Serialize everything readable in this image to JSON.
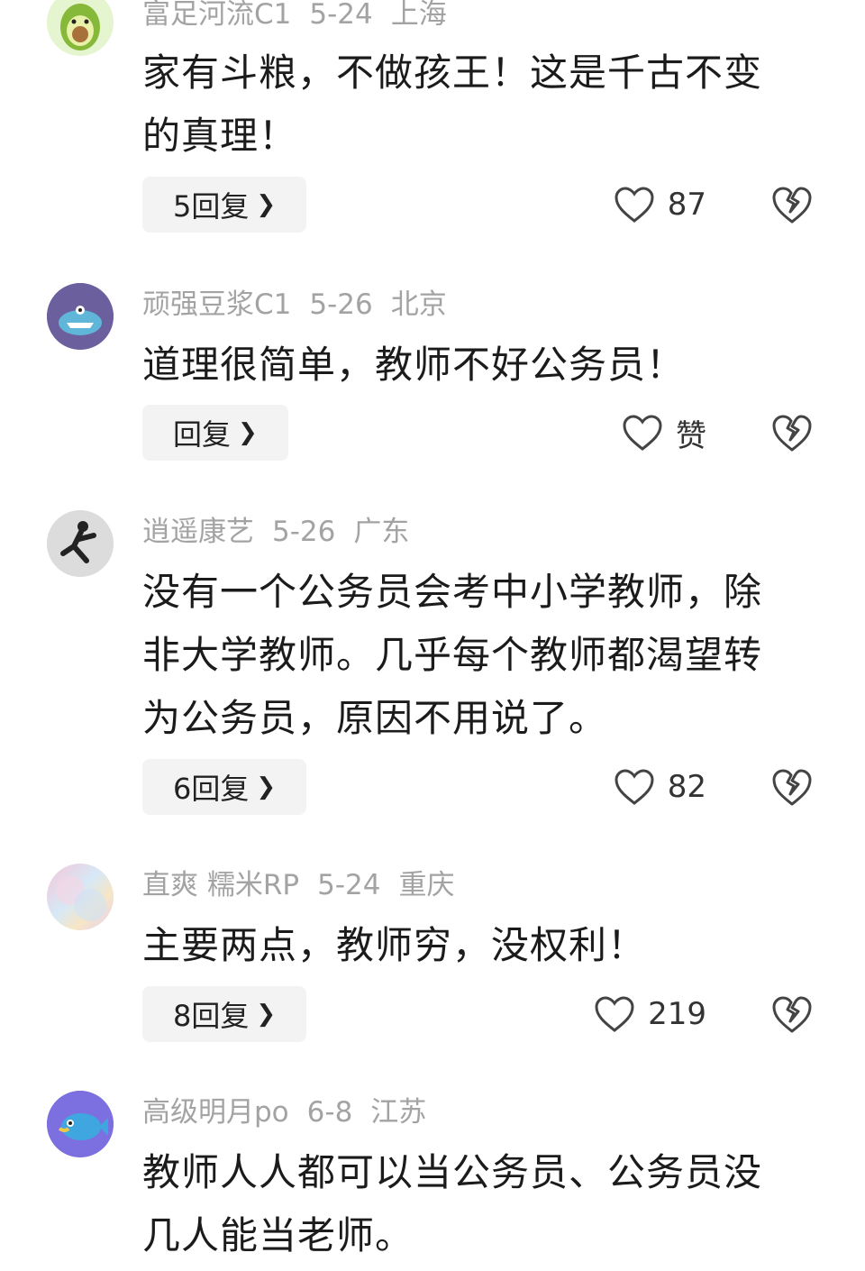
{
  "comments": [
    {
      "user": "富足河流C1",
      "date": "5-24",
      "location": "上海",
      "text": "家有斗粮，不做孩王！这是千古不变的真理！",
      "reply_label": "5回复",
      "likes": "87"
    },
    {
      "user": "顽强豆浆C1",
      "date": "5-26",
      "location": "北京",
      "text": "道理很简单，教师不好公务员！",
      "reply_label": "回复",
      "likes": "赞"
    },
    {
      "user": "逍遥康艺",
      "date": "5-26",
      "location": "广东",
      "text": "没有一个公务员会考中小学教师，除非大学教师。几乎每个教师都渴望转为公务员，原因不用说了。",
      "reply_label": "6回复",
      "likes": "82"
    },
    {
      "user": "直爽 糯米RP",
      "date": "5-24",
      "location": "重庆",
      "text": "主要两点，教师穷，没权利！",
      "reply_label": "8回复",
      "likes": "219"
    },
    {
      "user": "高级明月po",
      "date": "6-8",
      "location": "江苏",
      "text": "教师人人都可以当公务员、公务员没几人能当老师。"
    }
  ],
  "icons": {
    "like": "heart-outline-icon",
    "dislike": "broken-heart-icon",
    "reply_chevron": "chevron-right-icon"
  },
  "colors": {
    "meta": "#a3a3a3",
    "text": "#1b1b1b",
    "reply_bg": "#f3f3f3"
  }
}
